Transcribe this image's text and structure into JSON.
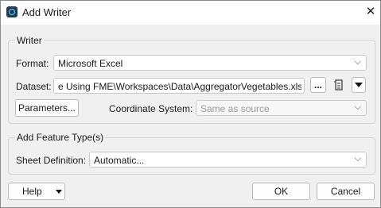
{
  "window": {
    "title": "Add Writer",
    "close_glyph": "✕"
  },
  "writer_group": {
    "label": "Writer",
    "format_label": "Format:",
    "format_value": "Microsoft Excel",
    "dataset_label": "Dataset:",
    "dataset_value": "e  Using FME\\Workspaces\\Data\\AggregatorVegetables.xlsx\"",
    "browse_label": "...",
    "parameters_label": "Parameters...",
    "coord_label": "Coordinate System:",
    "coord_value": "Same as source"
  },
  "feature_group": {
    "label": "Add Feature Type(s)",
    "sheet_label": "Sheet Definition:",
    "sheet_value": "Automatic..."
  },
  "footer": {
    "help_label": "Help",
    "ok_label": "OK",
    "cancel_label": "Cancel"
  },
  "icons": {
    "app": "fme-app-icon",
    "dataset_menu": "dataset-menu-icon",
    "dropdown": "chevron-down-icon"
  }
}
